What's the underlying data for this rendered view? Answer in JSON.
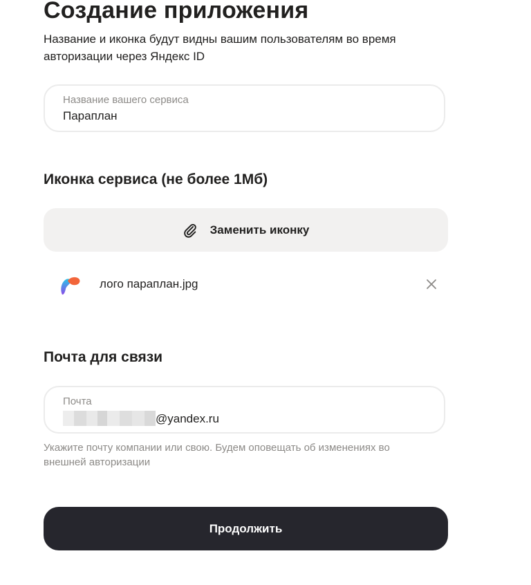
{
  "page": {
    "title": "Создание приложения",
    "subtitle": "Название и иконка будут видны вашим пользователям во время авторизации через Яндекс ID"
  },
  "service_name": {
    "label": "Название вашего сервиса",
    "value": "Параплан"
  },
  "icon_section": {
    "heading": "Иконка сервиса (не более 1Мб)",
    "replace_button_label": "Заменить иконку",
    "replace_button_icon": "paperclip-icon",
    "file": {
      "name": "лого параплан.jpg",
      "thumbnail_icon": "paraplan-logo-thumbnail",
      "remove_icon": "close-icon"
    }
  },
  "email_section": {
    "heading": "Почта для связи",
    "label": "Почта",
    "value_domain": "@yandex.ru",
    "value_local_part": "[blurred]",
    "hint": "Укажите почту компании или свою. Будем оповещать об изменениях во внешней авторизации"
  },
  "actions": {
    "continue_label": "Продолжить"
  },
  "colors": {
    "text": "#21201f",
    "muted": "#8c8a87",
    "field_border": "#ebebeb",
    "secondary_button": "#f2f1f0",
    "primary_button": "#26262d"
  }
}
